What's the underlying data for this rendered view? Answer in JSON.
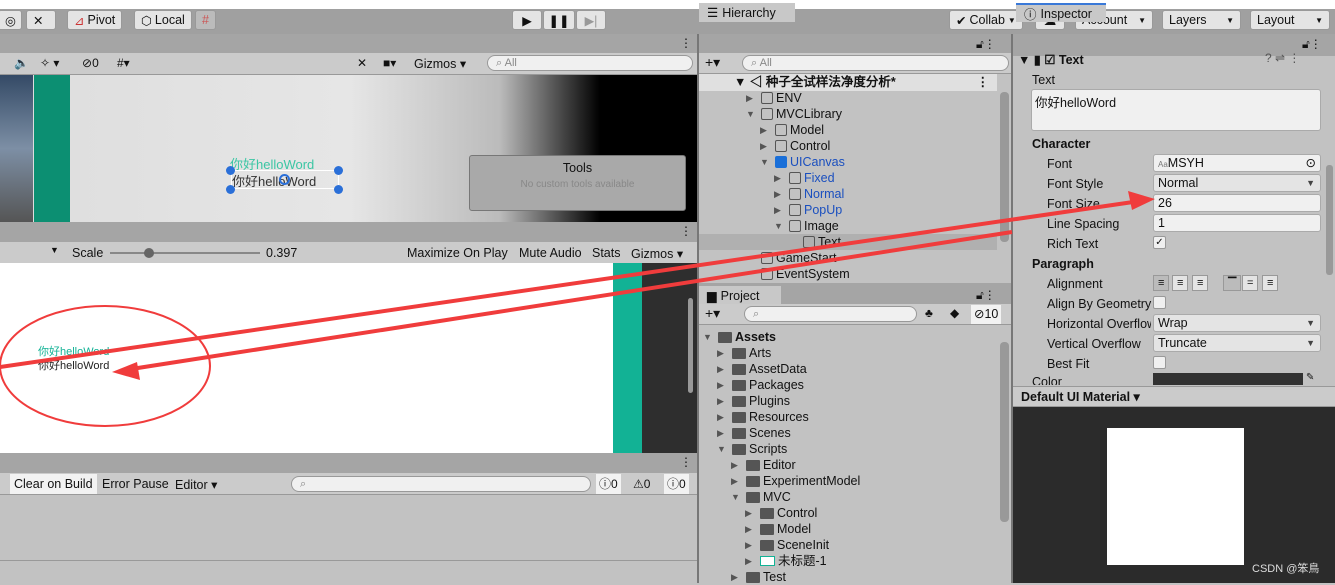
{
  "toolbar": {
    "pivot": "Pivot",
    "local": "Local",
    "collab": "Collab",
    "account": "Account",
    "layers": "Layers",
    "layout": "Layout"
  },
  "scene": {
    "hidden_count": "0",
    "gizmos": "Gizmos",
    "search_placeholder": "All",
    "text_teal": "你好helloWord",
    "text_dark": "你好helloWord",
    "tools_title": "Tools",
    "tools_msg": "No custom tools available"
  },
  "game": {
    "scale_label": "Scale",
    "scale_value": "0.397",
    "scale_fraction": 0.3,
    "maximize": "Maximize On Play",
    "mute": "Mute Audio",
    "stats": "Stats",
    "gizmos": "Gizmos",
    "text_teal": "你好helloWord",
    "text_dark": "你好helloWord"
  },
  "console": {
    "clear_on_build": "Clear on Build",
    "error_pause": "Error Pause",
    "editor": "Editor",
    "logs": "0",
    "warnings": "0",
    "errors": "0"
  },
  "hierarchy": {
    "tab": "Hierarchy",
    "search_placeholder": "All",
    "scene": "种子全试样法净度分析*",
    "items": [
      {
        "label": "ENV",
        "depth": 0,
        "exp": "▶"
      },
      {
        "label": "MVCLibrary",
        "depth": 0,
        "exp": "▼"
      },
      {
        "label": "Model",
        "depth": 1,
        "exp": "▶"
      },
      {
        "label": "Control",
        "depth": 1,
        "exp": "▶"
      },
      {
        "label": "UICanvas",
        "depth": 1,
        "exp": "▼",
        "blue": true
      },
      {
        "label": "Fixed",
        "depth": 2,
        "exp": "▶",
        "blue": true
      },
      {
        "label": "Normal",
        "depth": 2,
        "exp": "▶",
        "blue": true
      },
      {
        "label": "PopUp",
        "depth": 2,
        "exp": "▶",
        "blue": true
      },
      {
        "label": "Image",
        "depth": 2,
        "exp": "▼"
      },
      {
        "label": "Text",
        "depth": 3,
        "exp": "",
        "selected": true
      },
      {
        "label": "GameStart",
        "depth": 0,
        "exp": ""
      },
      {
        "label": "EventSystem",
        "depth": 0,
        "exp": ""
      }
    ]
  },
  "project": {
    "tab": "Project",
    "hidden_count": "10",
    "root": "Assets",
    "items": [
      {
        "label": "Arts",
        "depth": 1,
        "exp": "▶"
      },
      {
        "label": "AssetData",
        "depth": 1,
        "exp": "▶"
      },
      {
        "label": "Packages",
        "depth": 1,
        "exp": "▶"
      },
      {
        "label": "Plugins",
        "depth": 1,
        "exp": "▶"
      },
      {
        "label": "Resources",
        "depth": 1,
        "exp": "▶"
      },
      {
        "label": "Scenes",
        "depth": 1,
        "exp": "▶"
      },
      {
        "label": "Scripts",
        "depth": 1,
        "exp": "▼"
      },
      {
        "label": "Editor",
        "depth": 2,
        "exp": "▶"
      },
      {
        "label": "ExperimentModel",
        "depth": 2,
        "exp": "▶"
      },
      {
        "label": "MVC",
        "depth": 2,
        "exp": "▼"
      },
      {
        "label": "Control",
        "depth": 3,
        "exp": "▶"
      },
      {
        "label": "Model",
        "depth": 3,
        "exp": "▶"
      },
      {
        "label": "SceneInit",
        "depth": 3,
        "exp": "▶"
      },
      {
        "label": "未标题-1",
        "depth": 3,
        "exp": "▶",
        "image": true
      },
      {
        "label": "Test",
        "depth": 2,
        "exp": "▶"
      }
    ]
  },
  "inspector": {
    "tab": "Inspector",
    "component": "Text",
    "text_label": "Text",
    "text_value": "你好helloWord",
    "character": "Character",
    "font_label": "Font",
    "font_value": "MSYH",
    "font_style_label": "Font Style",
    "font_style_value": "Normal",
    "font_size_label": "Font Size",
    "font_size_value": "26",
    "line_spacing_label": "Line Spacing",
    "line_spacing_value": "1",
    "rich_text_label": "Rich Text",
    "paragraph": "Paragraph",
    "alignment_label": "Alignment",
    "align_geom_label": "Align By Geometry",
    "h_overflow_label": "Horizontal Overflow",
    "h_overflow_value": "Wrap",
    "v_overflow_label": "Vertical Overflow",
    "v_overflow_value": "Truncate",
    "best_fit_label": "Best Fit",
    "color_label": "Color",
    "color_value": "#323232",
    "material": "Default UI Material"
  },
  "watermark": "CSDN @笨鳥",
  "colors": {
    "teal": "#12b295",
    "annotation": "#f03c3c",
    "selection_blue": "#3a79d8"
  }
}
